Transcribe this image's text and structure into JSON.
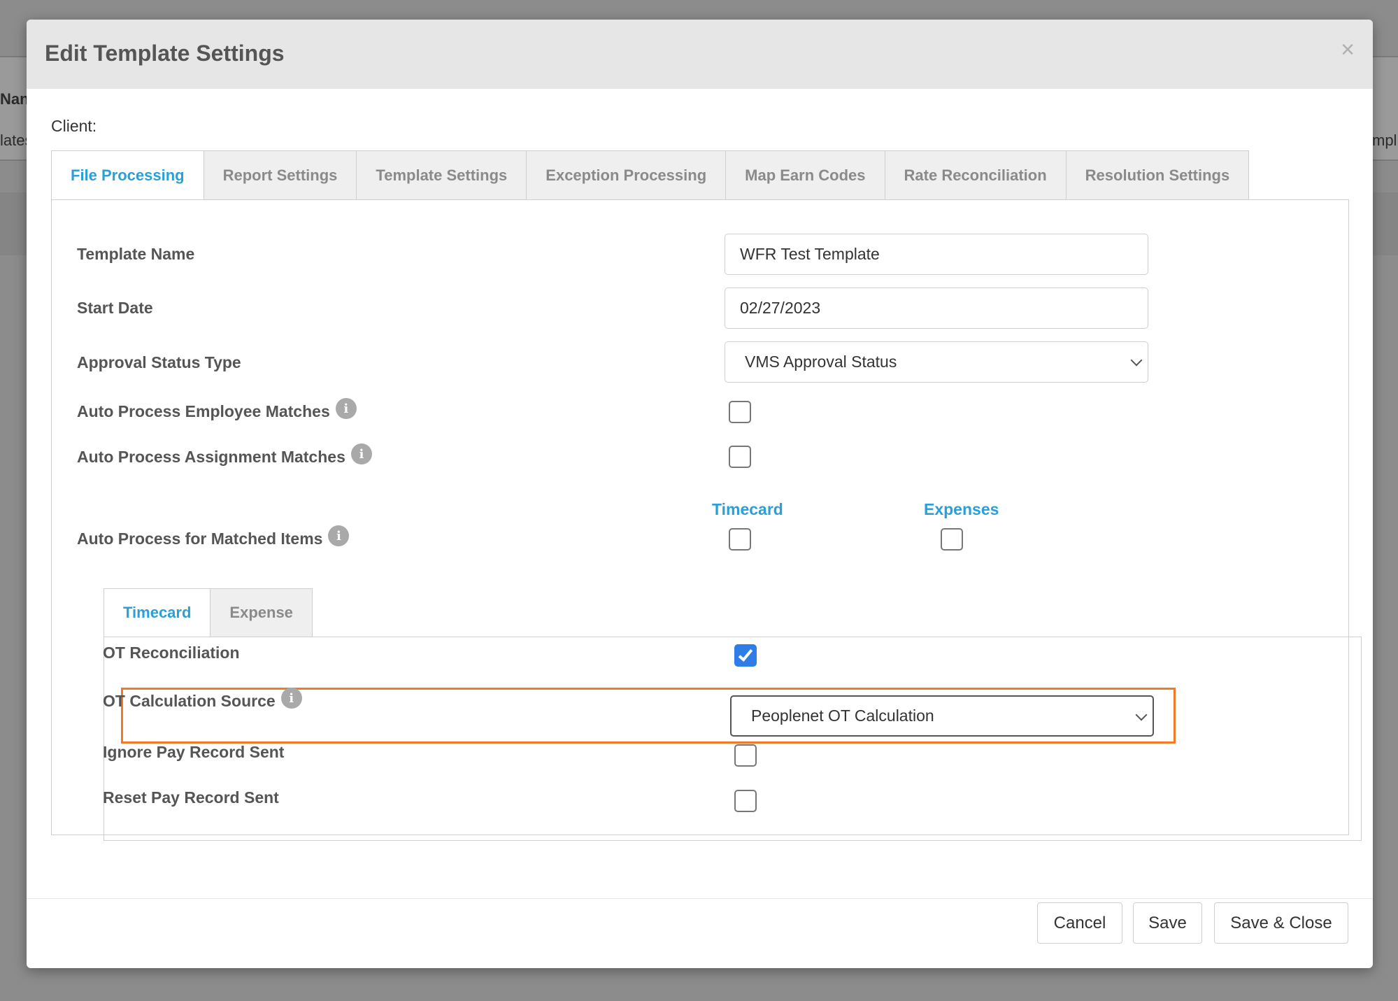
{
  "background": {
    "fragments": [
      "Nan",
      "lates",
      "mpl"
    ]
  },
  "modal": {
    "title": "Edit Template Settings",
    "close_label": "×",
    "client_label": "Client:"
  },
  "tabs": [
    {
      "label": "File Processing",
      "active": true
    },
    {
      "label": "Report Settings",
      "active": false
    },
    {
      "label": "Template Settings",
      "active": false
    },
    {
      "label": "Exception Processing",
      "active": false
    },
    {
      "label": "Map Earn Codes",
      "active": false
    },
    {
      "label": "Rate Reconciliation",
      "active": false
    },
    {
      "label": "Resolution Settings",
      "active": false
    }
  ],
  "form": {
    "template_name_label": "Template Name",
    "template_name_value": "WFR Test Template",
    "start_date_label": "Start Date",
    "start_date_value": "02/27/2023",
    "approval_status_label": "Approval Status Type",
    "approval_status_value": "VMS Approval Status",
    "auto_employee_label": "Auto Process Employee Matches",
    "auto_employee_checked": false,
    "auto_assignment_label": "Auto Process Assignment Matches",
    "auto_assignment_checked": false,
    "col_timecard": "Timecard",
    "col_expenses": "Expenses",
    "auto_matched_label": "Auto Process for Matched Items",
    "auto_matched_timecard_checked": false,
    "auto_matched_expenses_checked": false
  },
  "subtabs": [
    {
      "label": "Timecard",
      "active": true
    },
    {
      "label": "Expense",
      "active": false
    }
  ],
  "timecard": {
    "ot_reconciliation_label": "OT Reconciliation",
    "ot_reconciliation_checked": true,
    "ot_calc_source_label": "OT Calculation Source",
    "ot_calc_source_value": "Peoplenet OT Calculation",
    "ignore_pay_label": "Ignore Pay Record Sent",
    "ignore_pay_checked": false,
    "reset_pay_label": "Reset Pay Record Sent",
    "reset_pay_checked": false
  },
  "footer": {
    "cancel_label": "Cancel",
    "save_label": "Save",
    "save_close_label": "Save & Close"
  },
  "colors": {
    "accent": "#2a9fd8",
    "highlight": "#ef7a27",
    "checkbox_checked": "#2f7ee8"
  },
  "icons": {
    "info": "info-icon",
    "close": "close-icon",
    "chevron": "chevron-down-icon"
  }
}
